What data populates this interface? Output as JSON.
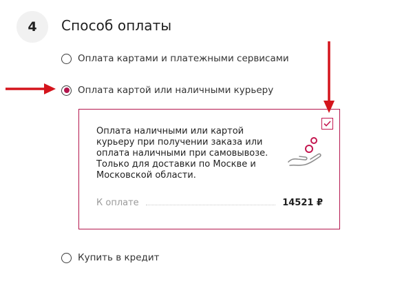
{
  "section": {
    "step": "4",
    "title": "Способ оплаты"
  },
  "options": [
    {
      "label": "Оплата картами и платежными сервисами",
      "selected": false
    },
    {
      "label": "Оплата картой или наличными курьеру",
      "selected": true
    },
    {
      "label": "Купить в кредит",
      "selected": false
    }
  ],
  "card": {
    "description": "Оплата наличными или картой\nкурьеру при получении заказа или\nоплата наличными при самовывозе.\nТолько для доставки по Москве и\nМосковской области.",
    "total_label": "К оплате",
    "total_value": "14521 ₽",
    "checkbox_checked": true,
    "icon": "hand-coins-icon"
  },
  "colors": {
    "accent": "#b3144c",
    "annotation_arrow": "#d4141c",
    "text": "#1f1f1f",
    "muted": "#9a9a9a"
  }
}
